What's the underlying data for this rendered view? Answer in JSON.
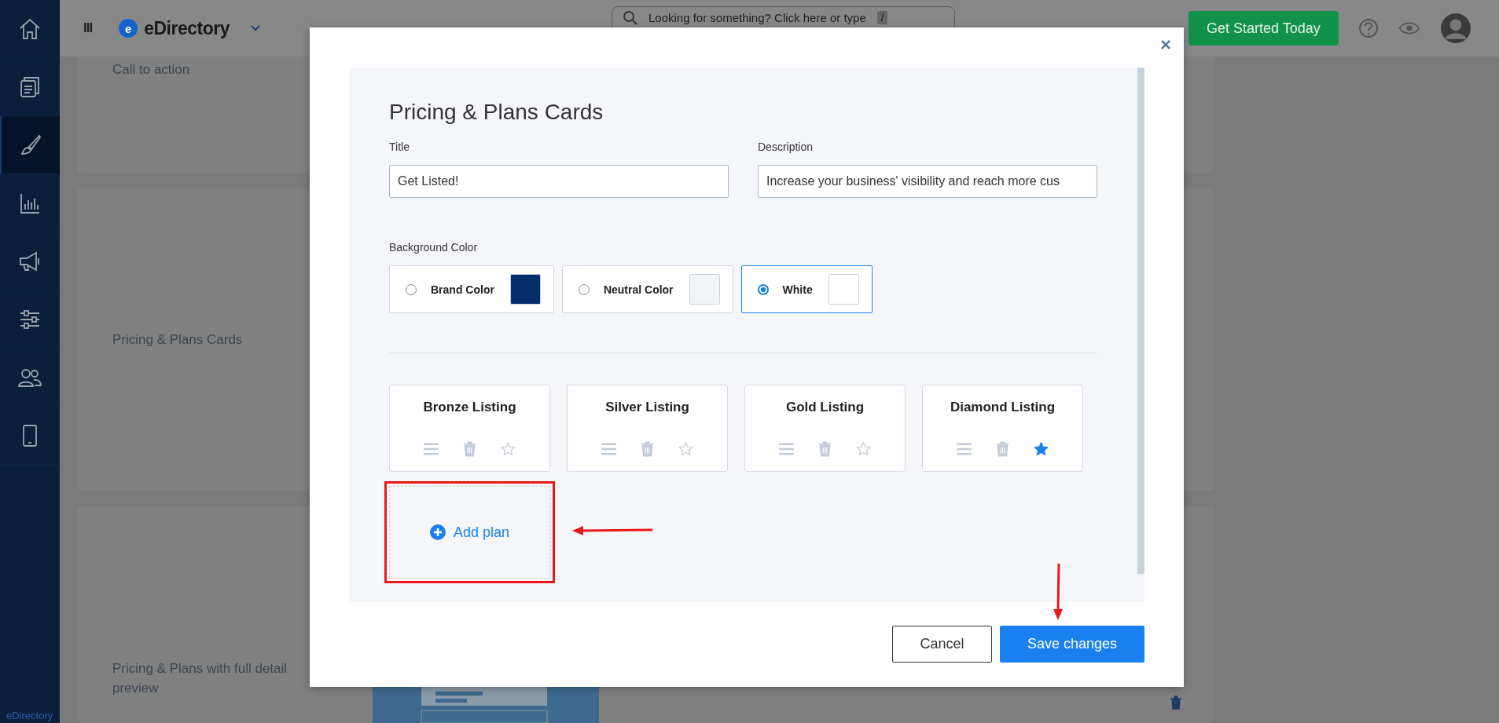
{
  "sidebar": {
    "items": [
      {
        "kind": "home",
        "selected": false
      },
      {
        "kind": "pages",
        "selected": false
      },
      {
        "kind": "brush",
        "selected": true
      },
      {
        "kind": "chart",
        "selected": false
      },
      {
        "kind": "megaphone",
        "selected": false
      },
      {
        "kind": "sliders",
        "selected": false
      },
      {
        "kind": "users",
        "selected": false
      },
      {
        "kind": "tablet",
        "selected": false
      }
    ],
    "footer": "eDirectory"
  },
  "topbar": {
    "menu": "III",
    "brand": "eDirectory",
    "brand_mark": "e",
    "search": {
      "placeholder": "Looking for something? Click here or type",
      "key": "/"
    },
    "cta": "Get Started Today"
  },
  "sections": [
    {
      "label": "Call to action"
    },
    {
      "label": "Pricing & Plans Cards"
    },
    {
      "label": "Pricing & Plans with full detail preview"
    }
  ],
  "modal": {
    "close": "×",
    "heading": "Pricing & Plans Cards",
    "fields": [
      {
        "label": "Title",
        "value": "Get Listed!"
      },
      {
        "label": "Description",
        "value": "Increase your business' visibility and reach more cus"
      }
    ],
    "background_color": {
      "label": "Background Color",
      "options": [
        {
          "label": "Brand Color",
          "color": "#032d6b",
          "selected": false
        },
        {
          "label": "Neutral Color",
          "color": "#f3f4f6",
          "selected": false
        },
        {
          "label": "White",
          "color": "#ffffff",
          "selected": true
        }
      ]
    },
    "plans": [
      {
        "name": "Bronze Listing",
        "featured": false
      },
      {
        "name": "Silver Listing",
        "featured": false
      },
      {
        "name": "Gold Listing",
        "featured": false
      },
      {
        "name": "Diamond Listing",
        "featured": true
      }
    ],
    "add_plan": "Add plan",
    "buttons": [
      {
        "label": "Cancel",
        "kind": "secondary"
      },
      {
        "label": "Save changes",
        "kind": "primary"
      }
    ]
  }
}
